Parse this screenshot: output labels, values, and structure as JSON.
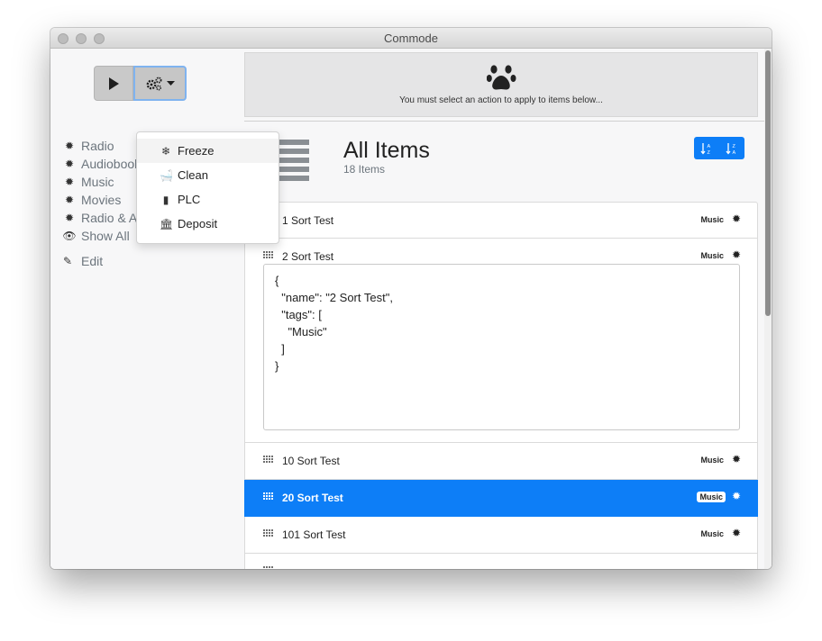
{
  "window": {
    "title": "Commode"
  },
  "toolbar": {
    "run_icon": "play-icon",
    "actions_icon": "gears-dropdown-icon"
  },
  "info_panel": {
    "icon": "paw-icon",
    "message": "You must select an action to apply to items below..."
  },
  "dropdown": {
    "items": [
      {
        "label": "Freeze",
        "icon": "snowflake-icon"
      },
      {
        "label": "Clean",
        "icon": "bath-icon"
      },
      {
        "label": "PLC",
        "icon": "microchip-icon"
      },
      {
        "label": "Deposit",
        "icon": "bank-icon"
      }
    ]
  },
  "sidebar": {
    "items": [
      {
        "label": "Radio",
        "icon": "gear-icon"
      },
      {
        "label": "Audiobooks",
        "icon": "gear-icon"
      },
      {
        "label": "Music",
        "icon": "gear-icon"
      },
      {
        "label": "Movies",
        "icon": "gear-icon"
      },
      {
        "label": "Radio & Audiobooks",
        "icon": "gear-icon"
      },
      {
        "label": "Show All",
        "icon": "eye-icon"
      }
    ],
    "edit": {
      "label": "Edit",
      "icon": "pencil-icon"
    }
  },
  "header": {
    "title": "All Items",
    "subtitle": "18 Items"
  },
  "sort": {
    "asc_label": "A-Z",
    "desc_label": "Z-A"
  },
  "items": [
    {
      "name": "1 Sort Test",
      "tag": "Music"
    },
    {
      "name": "2 Sort Test",
      "tag": "Music",
      "json": "{\n  \"name\": \"2 Sort Test\",\n  \"tags\": [\n    \"Music\"\n  ]\n}"
    },
    {
      "name": "10 Sort Test",
      "tag": "Music"
    },
    {
      "name": "20 Sort Test",
      "tag": "Music"
    },
    {
      "name": "101 Sort Test",
      "tag": "Music"
    }
  ],
  "colors": {
    "accent": "#0d7ef7",
    "selected_row": "#0d7ef7"
  }
}
